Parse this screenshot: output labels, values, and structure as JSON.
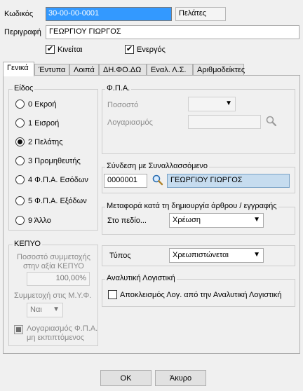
{
  "header": {
    "code_label": "Κωδικός",
    "code_value": "30-00-00-0001",
    "type_value": "Πελάτες",
    "desc_label": "Περιγραφή",
    "desc_value": "ΓΕΩΡΓΙΟΥ ΓΙΩΡΓΟΣ",
    "active_label": "Κινείται",
    "enabled_label": "Ενεργός"
  },
  "tabs": [
    "Γενικά",
    "Έντυπα",
    "Λοιπά",
    "ΔΗ.ΦΟ.ΔΩ",
    "Εναλ. Λ.Σ.",
    "Αριθμοδείκτες"
  ],
  "eidos": {
    "title": "Είδος",
    "options": [
      "0 Εκροή",
      "1 Εισροή",
      "2 Πελάτης",
      "3 Προμηθευτής",
      "4 Φ.Π.Α. Εσόδων",
      "5 Φ.Π.Α. Εξόδων",
      "9 Άλλο"
    ],
    "selected_index": 2
  },
  "kepyo": {
    "title": "ΚΕΠΥΟ",
    "pct_label_1": "Ποσοστό συμμετοχής",
    "pct_label_2": "στην αξία ΚΕΠΥΟ",
    "pct_value": "100,00%",
    "myf_label": "Συμμετοχή στις Μ.Υ.Φ.",
    "myf_value": "Ναι",
    "vat_chk_label_1": "Λογαριασμός Φ.Π.Α.",
    "vat_chk_label_2": "μη εκπιπτόμενος"
  },
  "fpa": {
    "title": "Φ.Π.Α.",
    "pct_label": "Ποσοστό",
    "account_label": "Λογαριασμός"
  },
  "link": {
    "title": "Σύνδεση με Συναλλασσόμενο",
    "code": "0000001",
    "name": "ΓΕΩΡΓΙΟΥ ΓΙΩΡΓΟΣ"
  },
  "transfer": {
    "title": "Μεταφορά κατά τη δημιουργία άρθρου / εγγραφής",
    "field_label": "Στο πεδίο...",
    "field_value": "Χρέωση"
  },
  "type": {
    "label": "Τύπος",
    "value": "Χρεωπιστώνεται"
  },
  "analytic": {
    "title": "Αναλυτική Λογιστική",
    "exclude_label": "Αποκλεισμός Λογ. από την Αναλυτική Λογιστική"
  },
  "buttons": {
    "ok": "OK",
    "cancel": "Άκυρο"
  }
}
